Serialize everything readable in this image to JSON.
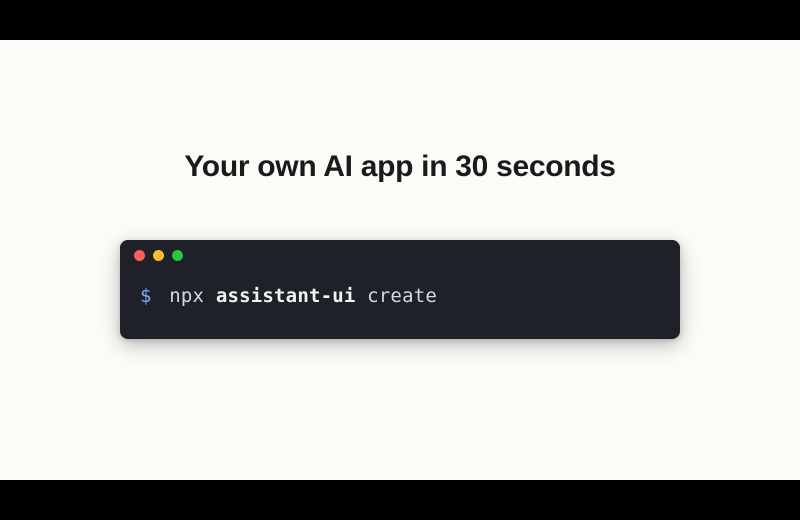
{
  "heading": "Your own AI app in 30 seconds",
  "terminal": {
    "traffic_lights": {
      "close": "red",
      "minimize": "yellow",
      "zoom": "green"
    },
    "prompt": "$",
    "command": {
      "binary": "npx",
      "package": "assistant-ui",
      "arg": "create"
    }
  }
}
